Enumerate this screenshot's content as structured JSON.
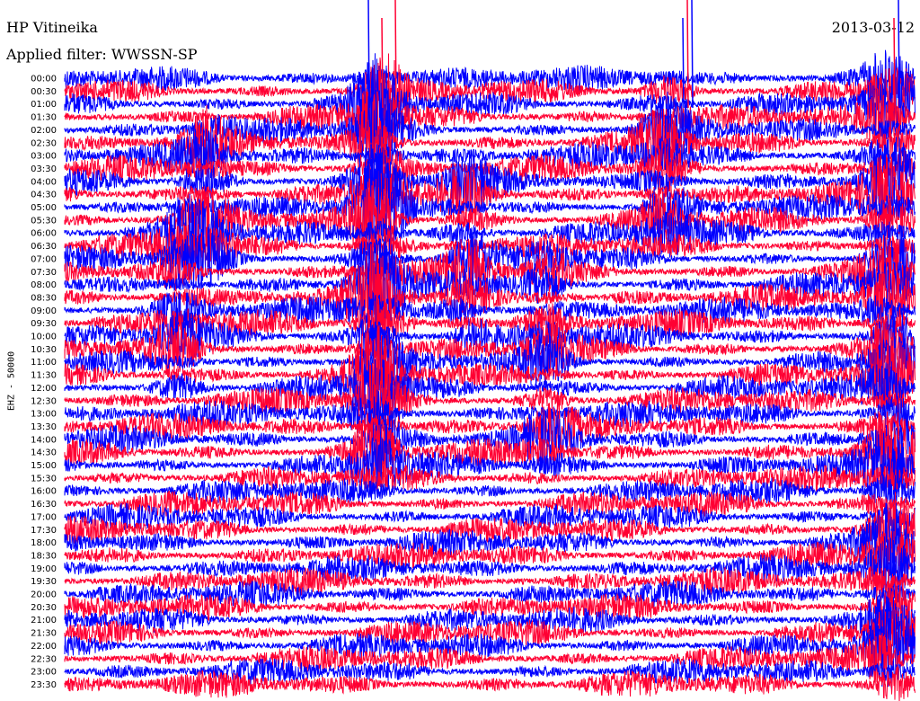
{
  "header": {
    "station": "HP Vitineika",
    "date": "2013-03-12",
    "filter": "Applied filter: WWSSN-SP"
  },
  "colors": {
    "trace_a": "#0000ff",
    "trace_b": "#ff0033",
    "background": "#ffffff"
  },
  "chart_data": {
    "type": "line",
    "title": "HP Vitineika",
    "ylabel": "EHZ - 50000",
    "y_tick_labels": [
      "00:00",
      "00:30",
      "01:00",
      "01:30",
      "02:00",
      "02:30",
      "03:00",
      "03:30",
      "04:00",
      "04:30",
      "05:00",
      "05:30",
      "06:00",
      "06:30",
      "07:00",
      "07:30",
      "08:00",
      "08:30",
      "09:00",
      "09:30",
      "10:00",
      "10:30",
      "11:00",
      "11:30",
      "12:00",
      "12:30",
      "13:00",
      "13:30",
      "14:00",
      "14:30",
      "15:00",
      "15:30",
      "16:00",
      "16:30",
      "17:00",
      "17:30",
      "18:00",
      "18:30",
      "19:00",
      "19:30",
      "20:00",
      "20:30",
      "21:00",
      "21:30",
      "22:00",
      "22:30",
      "23:00",
      "23:30"
    ],
    "series": [
      {
        "color": "#0000ff",
        "rows": "even"
      },
      {
        "color": "#ff0033",
        "rows": "odd"
      }
    ],
    "grid": false,
    "legend": "none"
  }
}
